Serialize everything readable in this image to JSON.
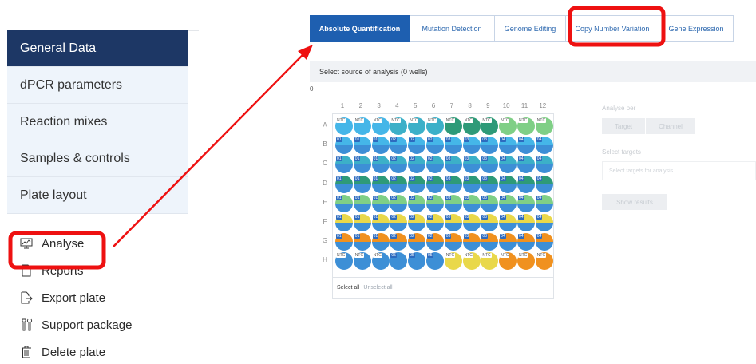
{
  "sidebar": {
    "items": [
      {
        "label": "General Data",
        "active": true
      },
      {
        "label": "dPCR parameters",
        "active": false
      },
      {
        "label": "Reaction mixes",
        "active": false
      },
      {
        "label": "Samples & controls",
        "active": false
      },
      {
        "label": "Plate layout",
        "active": false
      }
    ],
    "actions": [
      {
        "label": "Analyse",
        "icon": "monitor-chart-icon"
      },
      {
        "label": "Reports",
        "icon": "document-icon"
      },
      {
        "label": "Export plate",
        "icon": "export-icon"
      },
      {
        "label": "Support package",
        "icon": "tools-icon"
      },
      {
        "label": "Delete plate",
        "icon": "trash-icon"
      }
    ]
  },
  "tabs": [
    {
      "label": "Absolute Quantification",
      "active": true
    },
    {
      "label": "Mutation Detection",
      "active": false
    },
    {
      "label": "Genome Editing",
      "active": false
    },
    {
      "label": "Copy Number Variation",
      "active": false
    },
    {
      "label": "Gene Expression",
      "active": false
    }
  ],
  "source_bar": {
    "text": "Select source of analysis (0 wells)"
  },
  "zero_marker": "0",
  "plate": {
    "columns": [
      "1",
      "2",
      "3",
      "4",
      "5",
      "6",
      "7",
      "8",
      "9",
      "10",
      "11",
      "12"
    ],
    "rows": [
      "A",
      "B",
      "C",
      "D",
      "E",
      "F",
      "G",
      "H"
    ],
    "well_labels": [
      [
        "NTC",
        "NTC",
        "NTC",
        "NTC",
        "NTC",
        "NTC",
        "NTC",
        "NTC",
        "NTC",
        "NTC",
        "NTC",
        "NTC"
      ],
      [
        "01",
        "01",
        "01",
        "02",
        "02",
        "02",
        "03",
        "03",
        "03",
        "04",
        "04",
        "04"
      ],
      [
        "01",
        "01",
        "01",
        "02",
        "02",
        "02",
        "03",
        "03",
        "03",
        "04",
        "04",
        "04"
      ],
      [
        "01",
        "01",
        "01",
        "02",
        "02",
        "02",
        "03",
        "03",
        "03",
        "04",
        "04",
        "04"
      ],
      [
        "01",
        "01",
        "01",
        "02",
        "02",
        "02",
        "03",
        "03",
        "03",
        "04",
        "04",
        "04"
      ],
      [
        "01",
        "01",
        "01",
        "02",
        "02",
        "02",
        "03",
        "03",
        "03",
        "04",
        "04",
        "04"
      ],
      [
        "01",
        "01",
        "01",
        "02",
        "02",
        "02",
        "03",
        "03",
        "03",
        "04",
        "04",
        "04"
      ],
      [
        "NTC",
        "NTC",
        "NTC",
        "05",
        "05",
        "05",
        "NTC",
        "NTC",
        "NTC",
        "NTC",
        "NTC",
        "NTC"
      ]
    ],
    "well_colors": [
      [
        [
          "#45b6e8",
          "#45b6e8"
        ],
        [
          "#45b6e8",
          "#45b6e8"
        ],
        [
          "#45b6e8",
          "#45b6e8"
        ],
        [
          "#3cb0c8",
          "#3cb0c8"
        ],
        [
          "#3cb0c8",
          "#3cb0c8"
        ],
        [
          "#3cb0c8",
          "#3cb0c8"
        ],
        [
          "#2e9a78",
          "#2e9a78"
        ],
        [
          "#2e9a78",
          "#2e9a78"
        ],
        [
          "#2e9a78",
          "#2e9a78"
        ],
        [
          "#7fcf86",
          "#7fcf86"
        ],
        [
          "#7fcf86",
          "#7fcf86"
        ],
        [
          "#7fcf86",
          "#7fcf86"
        ]
      ],
      [
        [
          "#45b6e8",
          "#3d8fd6"
        ],
        [
          "#45b6e8",
          "#3d8fd6"
        ],
        [
          "#45b6e8",
          "#3d8fd6"
        ],
        [
          "#45b6e8",
          "#3d8fd6"
        ],
        [
          "#45b6e8",
          "#3d8fd6"
        ],
        [
          "#45b6e8",
          "#3d8fd6"
        ],
        [
          "#45b6e8",
          "#3d8fd6"
        ],
        [
          "#45b6e8",
          "#3d8fd6"
        ],
        [
          "#45b6e8",
          "#3d8fd6"
        ],
        [
          "#45b6e8",
          "#3d8fd6"
        ],
        [
          "#45b6e8",
          "#3d8fd6"
        ],
        [
          "#45b6e8",
          "#3d8fd6"
        ]
      ],
      [
        [
          "#3cb0c8",
          "#3d8fd6"
        ],
        [
          "#3cb0c8",
          "#3d8fd6"
        ],
        [
          "#3cb0c8",
          "#3d8fd6"
        ],
        [
          "#3cb0c8",
          "#3d8fd6"
        ],
        [
          "#3cb0c8",
          "#3d8fd6"
        ],
        [
          "#3cb0c8",
          "#3d8fd6"
        ],
        [
          "#3cb0c8",
          "#3d8fd6"
        ],
        [
          "#3cb0c8",
          "#3d8fd6"
        ],
        [
          "#3cb0c8",
          "#3d8fd6"
        ],
        [
          "#3cb0c8",
          "#3d8fd6"
        ],
        [
          "#3cb0c8",
          "#3d8fd6"
        ],
        [
          "#3cb0c8",
          "#3d8fd6"
        ]
      ],
      [
        [
          "#2e9a78",
          "#3d8fd6"
        ],
        [
          "#2e9a78",
          "#3d8fd6"
        ],
        [
          "#2e9a78",
          "#3d8fd6"
        ],
        [
          "#2e9a78",
          "#3d8fd6"
        ],
        [
          "#2e9a78",
          "#3d8fd6"
        ],
        [
          "#2e9a78",
          "#3d8fd6"
        ],
        [
          "#2e9a78",
          "#3d8fd6"
        ],
        [
          "#2e9a78",
          "#3d8fd6"
        ],
        [
          "#2e9a78",
          "#3d8fd6"
        ],
        [
          "#2e9a78",
          "#3d8fd6"
        ],
        [
          "#2e9a78",
          "#3d8fd6"
        ],
        [
          "#2e9a78",
          "#3d8fd6"
        ]
      ],
      [
        [
          "#7fcf86",
          "#3d8fd6"
        ],
        [
          "#7fcf86",
          "#3d8fd6"
        ],
        [
          "#7fcf86",
          "#3d8fd6"
        ],
        [
          "#7fcf86",
          "#3d8fd6"
        ],
        [
          "#7fcf86",
          "#3d8fd6"
        ],
        [
          "#7fcf86",
          "#3d8fd6"
        ],
        [
          "#7fcf86",
          "#3d8fd6"
        ],
        [
          "#7fcf86",
          "#3d8fd6"
        ],
        [
          "#7fcf86",
          "#3d8fd6"
        ],
        [
          "#7fcf86",
          "#3d8fd6"
        ],
        [
          "#7fcf86",
          "#3d8fd6"
        ],
        [
          "#7fcf86",
          "#3d8fd6"
        ]
      ],
      [
        [
          "#e9d84a",
          "#3d8fd6"
        ],
        [
          "#e9d84a",
          "#3d8fd6"
        ],
        [
          "#e9d84a",
          "#3d8fd6"
        ],
        [
          "#e9d84a",
          "#3d8fd6"
        ],
        [
          "#e9d84a",
          "#3d8fd6"
        ],
        [
          "#e9d84a",
          "#3d8fd6"
        ],
        [
          "#e9d84a",
          "#3d8fd6"
        ],
        [
          "#e9d84a",
          "#3d8fd6"
        ],
        [
          "#e9d84a",
          "#3d8fd6"
        ],
        [
          "#e9d84a",
          "#3d8fd6"
        ],
        [
          "#e9d84a",
          "#3d8fd6"
        ],
        [
          "#e9d84a",
          "#3d8fd6"
        ]
      ],
      [
        [
          "#f0911f",
          "#3d8fd6"
        ],
        [
          "#f0911f",
          "#3d8fd6"
        ],
        [
          "#f0911f",
          "#3d8fd6"
        ],
        [
          "#f0911f",
          "#3d8fd6"
        ],
        [
          "#f0911f",
          "#3d8fd6"
        ],
        [
          "#f0911f",
          "#3d8fd6"
        ],
        [
          "#f0911f",
          "#3d8fd6"
        ],
        [
          "#f0911f",
          "#3d8fd6"
        ],
        [
          "#f0911f",
          "#3d8fd6"
        ],
        [
          "#f0911f",
          "#3d8fd6"
        ],
        [
          "#f0911f",
          "#3d8fd6"
        ],
        [
          "#f0911f",
          "#3d8fd6"
        ]
      ],
      [
        [
          "#3d8fd6",
          "#3d8fd6"
        ],
        [
          "#3d8fd6",
          "#3d8fd6"
        ],
        [
          "#3d8fd6",
          "#3d8fd6"
        ],
        [
          "#3d8fd6",
          "#3d8fd6"
        ],
        [
          "#3d8fd6",
          "#3d8fd6"
        ],
        [
          "#3d8fd6",
          "#3d8fd6"
        ],
        [
          "#e9d84a",
          "#e9d84a"
        ],
        [
          "#e9d84a",
          "#e9d84a"
        ],
        [
          "#e9d84a",
          "#e9d84a"
        ],
        [
          "#f0911f",
          "#f0911f"
        ],
        [
          "#f0911f",
          "#f0911f"
        ],
        [
          "#f0911f",
          "#f0911f"
        ]
      ]
    ],
    "select_all": "Select all",
    "unselect_all": "Unselect all"
  },
  "analyse_panel": {
    "analyse_per_label": "Analyse per",
    "target_btn": "Target",
    "channel_btn": "Channel",
    "select_targets_label": "Select targets",
    "select_targets_placeholder": "Select targets for analysis",
    "show_results_btn": "Show results"
  },
  "annotation_color": "#ee1111"
}
